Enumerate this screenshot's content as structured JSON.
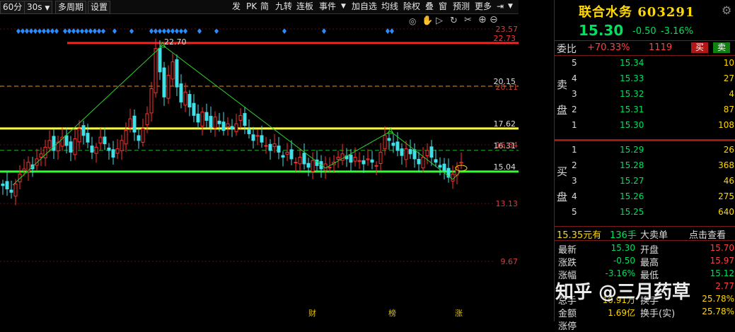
{
  "toolbar": {
    "items": [
      "60分",
      "30s",
      "多周期",
      "设置",
      "发",
      "PK",
      "简",
      "九转",
      "连板",
      "事件",
      "加自选",
      "均线",
      "除权",
      "叠",
      "窗",
      "预测",
      "更多"
    ],
    "dropdown_arrow": "chevron-down-icon",
    "pin_icon": "pin-icon"
  },
  "chart_data": {
    "type": "candlestick",
    "y_axis_labels": [
      "23.57",
      "20.11",
      "16.64",
      "13.13",
      "9.67"
    ],
    "y_levels": [
      23.57,
      20.11,
      16.64,
      13.13,
      9.67
    ],
    "horizontal_lines": [
      {
        "value": 22.73,
        "label": "22.73",
        "color": "#ff2020",
        "style": "solid"
      },
      {
        "value": 20.15,
        "label": "20.15",
        "color": "#d8a000",
        "style": "dashed"
      },
      {
        "value": 17.62,
        "label": "17.62",
        "color": "#ffff40",
        "style": "solid"
      },
      {
        "value": 16.31,
        "label": "16.31",
        "color": "#20c020",
        "style": "dashed"
      },
      {
        "value": 15.04,
        "label": "15.04",
        "color": "#30ff30",
        "style": "solid"
      }
    ],
    "peak_label": "22.70",
    "bottom_flags": [
      "财",
      "榜",
      "涨"
    ],
    "colors": {
      "up": "#ff3030",
      "down": "#40e0e8",
      "trend": "#30d030"
    }
  },
  "stock": {
    "name": "联合水务",
    "code": "603291",
    "price": "15.30",
    "change": "-0.50",
    "change_pct": "-3.16%"
  },
  "orderbook": {
    "weibi_label": "委比",
    "weibi_value": "+70.33%",
    "weibi_diff": "1119",
    "buy_btn": "买",
    "sell_btn": "卖",
    "sell_side_label": "卖盘",
    "buy_side_label": "买盘",
    "sell": [
      {
        "idx": "5",
        "price": "15.34",
        "vol": "10"
      },
      {
        "idx": "4",
        "price": "15.33",
        "vol": "27"
      },
      {
        "idx": "3",
        "price": "15.32",
        "vol": "4"
      },
      {
        "idx": "2",
        "price": "15.31",
        "vol": "87"
      },
      {
        "idx": "1",
        "price": "15.30",
        "vol": "108"
      }
    ],
    "buy": [
      {
        "idx": "1",
        "price": "15.29",
        "vol": "26"
      },
      {
        "idx": "2",
        "price": "15.28",
        "vol": "368"
      },
      {
        "idx": "3",
        "price": "15.27",
        "vol": "46"
      },
      {
        "idx": "4",
        "price": "15.26",
        "vol": "275"
      },
      {
        "idx": "5",
        "price": "15.25",
        "vol": "640"
      }
    ]
  },
  "bigorder": {
    "text1": "15.35元有",
    "text2": "136手",
    "text3": "大卖单",
    "link": "点击查看"
  },
  "stats": {
    "latest_label": "最新",
    "latest": "15.30",
    "open_label": "开盘",
    "open": "15.70",
    "chg_label": "涨跌",
    "chg": "-0.50",
    "high_label": "最高",
    "high": "15.97",
    "pct_label": "涨幅",
    "pct": "-3.16%",
    "low_label": "最低",
    "low": "15.12",
    "r4_label": "总手",
    "r4_val": "10.91万",
    "r4b_label": "换手",
    "r4b_val": "25.78%",
    "amt_label": "金额",
    "amt": "1.69亿",
    "turn_label": "换手(实)",
    "turn": "25.78%",
    "vol_r_label": "量比",
    "vol_r": "2.77",
    "r6_label": "涨停"
  },
  "watermark": "知乎 @三月药草"
}
